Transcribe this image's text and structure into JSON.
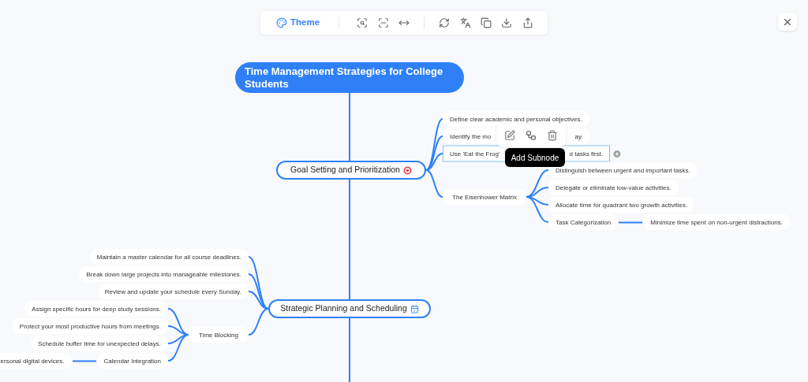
{
  "toolbar": {
    "theme_button": "Theme"
  },
  "root": {
    "title": "Time Management Strategies for College Students"
  },
  "branches": [
    {
      "label": "Goal Setting and Prioritization",
      "children": [
        {
          "label": "Define clear academic and personal objectives.",
          "selected": false
        },
        {
          "label_start": "Identify the mo",
          "label_end": "ay.",
          "selected": false
        },
        {
          "label_start": "Use 'Eat the Frog'",
          "label_end": "d tasks first.",
          "selected": true
        },
        {
          "label": "The Eisenhower Matrix",
          "selected": false,
          "children": [
            {
              "label": "Distinguish between urgent and important tasks.",
              "selected": false
            },
            {
              "label": "Delegate or eliminate low-value activities.",
              "selected": false
            },
            {
              "label": "Allocate time for quadrant two growth activities.",
              "selected": false
            },
            {
              "label": "Task Categorization",
              "selected": false,
              "children": [
                {
                  "label": "Minimize time spent on non-urgent distractions.",
                  "selected": false
                }
              ]
            }
          ]
        }
      ]
    },
    {
      "label": "Strategic Planning and Scheduling",
      "children": [
        {
          "label": "Maintain a master calendar for all course deadlines.",
          "selected": false
        },
        {
          "label": "Break down large projects into manageable milestones.",
          "selected": false
        },
        {
          "label": "Review and update your schedule every Sunday.",
          "selected": false
        },
        {
          "label": "Time Blocking",
          "selected": false,
          "children": [
            {
              "label": "Assign specific hours for deep study sessions.",
              "selected": false
            },
            {
              "label": "Protect your most productive hours from meetings.",
              "selected": false
            },
            {
              "label": "Schedule buffer time for unexpected delays.",
              "selected": false
            },
            {
              "label": "Calendar Integration",
              "selected": false,
              "children": [
                {
                  "label": "ersonal digital devices.",
                  "selected": false
                }
              ]
            }
          ]
        }
      ]
    }
  ],
  "node_toolbar": {
    "tooltip": "Add Subnode"
  }
}
